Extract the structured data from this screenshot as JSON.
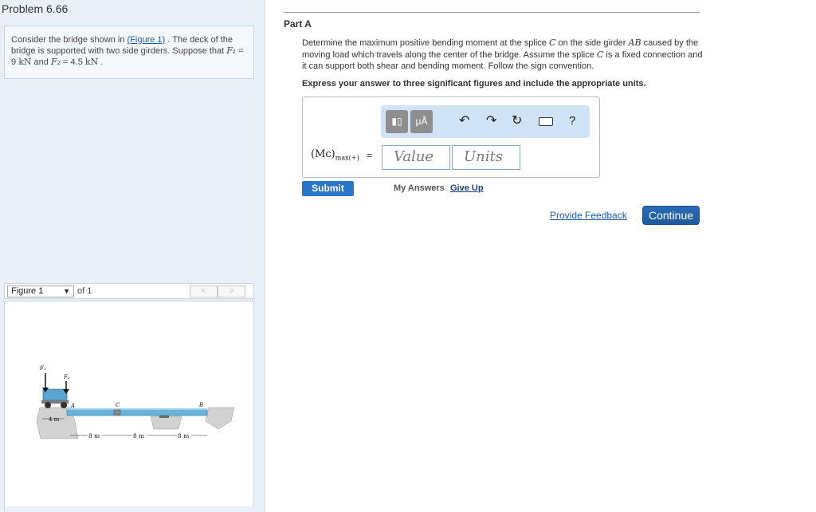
{
  "problem": {
    "title": "Problem 6.66",
    "text_start": "Consider the bridge shown in ",
    "figure_link": "(Figure 1)",
    "text_mid": " . The deck of the bridge is supported with two side girders. Suppose that ",
    "f1_symbol": "F₁",
    "f1_value": " = 9 ",
    "f1_unit": "kN",
    "and_word": " and ",
    "f2_symbol": "F₂",
    "f2_value": " = 4.5 ",
    "f2_unit": "kN",
    "end": " ."
  },
  "figure": {
    "select_label": "Figure 1",
    "of_label": "of 1",
    "prev": "<",
    "next": ">",
    "labels": {
      "f1": "F₁",
      "f2": "F₂",
      "a": "A",
      "c": "C",
      "b": "B",
      "dim_4m": "4 m",
      "dim_8m_1": "8 m",
      "dim_8m_2": "8 m",
      "dim_8m_3": "8 m"
    }
  },
  "part": {
    "title": "Part A",
    "q1": "Determine the maximum positive bending moment at the splice ",
    "q_c": "C",
    "q2": " on the side girder ",
    "q_ab": "AB",
    "q3": " caused by the moving load which travels along the center of the bridge. Assume the splice ",
    "q_c2": "C",
    "q4": " is a fixed connection and it can support both shear and bending moment. Follow the sign convention.",
    "instruction": "Express your answer to three significant figures and include the appropriate units."
  },
  "answer": {
    "label_main": "(Mᴄ)",
    "label_sub": "max(+)",
    "equals": "=",
    "value_placeholder": "Value",
    "units_placeholder": "Units",
    "mu_label": "μÅ"
  },
  "actions": {
    "submit": "Submit",
    "my_answers": "My Answers",
    "give_up": "Give Up",
    "feedback": "Provide Feedback",
    "continue": "Continue"
  },
  "colors": {
    "accent": "#2776c8",
    "left_bg": "#eaf0f7",
    "toolbar_bg": "#cfe2f6"
  }
}
